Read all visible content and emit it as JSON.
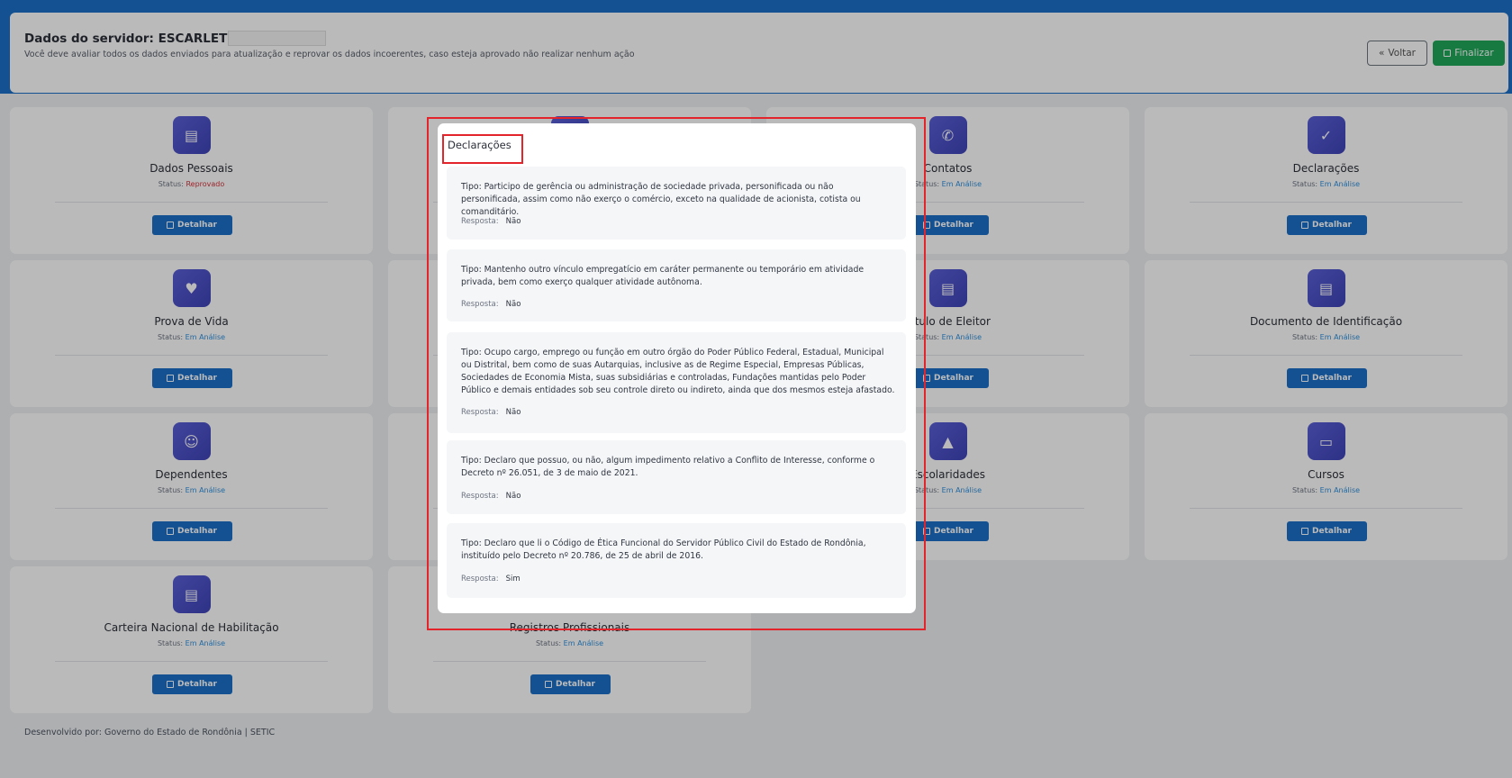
{
  "header": {
    "title": "Dados do servidor: ESCARLET",
    "subtitle": "Você deve avaliar todos os dados enviados para atualização e reprovar os dados incoerentes, caso esteja aprovado não realizar nenhum ação",
    "back_label": "Voltar",
    "finish_label": "Finalizar"
  },
  "status_label": "Status:",
  "detail_label": "Detalhar",
  "cards": [
    {
      "title": "Dados Pessoais",
      "status": "Reprovado",
      "icon": "id-card-icon"
    },
    {
      "title": "",
      "status": "",
      "icon": "home-icon"
    },
    {
      "title": "Contatos",
      "status": "Em Análise",
      "icon": "phone-icon"
    },
    {
      "title": "Declarações",
      "status": "Em Análise",
      "icon": "file-check-icon"
    },
    {
      "title": "Prova de Vida",
      "status": "Em Análise",
      "icon": "heart-pulse-icon"
    },
    {
      "title": "",
      "status": "",
      "icon": "briefcase-icon"
    },
    {
      "title": "Título de Eleitor",
      "status": "Em Análise",
      "icon": "id-card-icon"
    },
    {
      "title": "Documento de Identificação",
      "status": "Em Análise",
      "icon": "id-card-icon"
    },
    {
      "title": "Dependentes",
      "status": "Em Análise",
      "icon": "user-child-icon"
    },
    {
      "title": "",
      "status": "",
      "icon": "bank-icon"
    },
    {
      "title": "Escolaridades",
      "status": "Em Análise",
      "icon": "graduation-cap-icon"
    },
    {
      "title": "Cursos",
      "status": "Em Análise",
      "icon": "presentation-icon"
    },
    {
      "title": "Carteira Nacional de Habilitação",
      "status": "Em Análise",
      "icon": "id-card-icon"
    },
    {
      "title": "Registros Profissionais",
      "status": "Em Análise",
      "icon": "certificate-icon"
    }
  ],
  "footer": "Desenvolvido por: Governo do Estado de Rondônia | SETIC",
  "modal": {
    "title": "Declarações",
    "answer_label": "Resposta:",
    "items": [
      {
        "tipo": "Tipo: Participo de gerência ou administração de sociedade privada, personificada ou não personificada, assim como não exerço o comércio, exceto na qualidade de acionista, cotista ou comanditário.",
        "resposta": "Não"
      },
      {
        "tipo": "Tipo: Mantenho outro vínculo empregatício em caráter permanente ou temporário em atividade privada, bem como exerço qualquer atividade autônoma.",
        "resposta": "Não"
      },
      {
        "tipo": "Tipo: Ocupo cargo, emprego ou função em outro órgão do Poder Público Federal, Estadual, Municipal ou Distrital, bem como de suas Autarquias, inclusive as de Regime Especial, Empresas Públicas, Sociedades de Economia Mista, suas subsidiárias e controladas, Fundações mantidas pelo Poder Público e demais entidades sob seu controle direto ou indireto, ainda que dos mesmos esteja afastado.",
        "resposta": "Não"
      },
      {
        "tipo": "Tipo: Declaro que possuo, ou não, algum impedimento relativo a Conflito de Interesse, conforme o Decreto nº 26.051, de 3 de maio de 2021.",
        "resposta": "Não"
      },
      {
        "tipo": "Tipo: Declaro que li o Código de Ética Funcional do Servidor Público Civil do Estado de Rondônia, instituído pelo Decreto nº 20.786, de 25 de abril de 2016.",
        "resposta": "Sim"
      }
    ]
  },
  "colors": {
    "primary": "#1b6fc9",
    "success": "#1fa85a",
    "rejected": "#d6333b",
    "in_review": "#2f8fdc",
    "annotation": "#e3242b"
  }
}
